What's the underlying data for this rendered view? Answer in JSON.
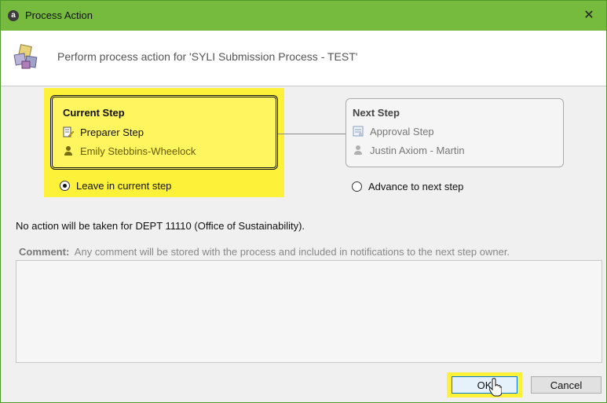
{
  "window": {
    "title": "Process Action",
    "app_icon_letter": "a",
    "close_glyph": "✕"
  },
  "header": {
    "text": "Perform process action for 'SYLI Submission Process - TEST'",
    "icon": "process-cubes-icon"
  },
  "current_step": {
    "title": "Current Step",
    "step_name": "Preparer Step",
    "step_icon": "edit-document-icon",
    "owner": "Emily Stebbins-Wheelock",
    "owner_icon": "user-icon"
  },
  "next_step": {
    "title": "Next Step",
    "step_name": "Approval Step",
    "step_icon": "approval-document-icon",
    "owner": "Justin Axiom - Martin",
    "owner_icon": "user-icon"
  },
  "options": {
    "leave_label": "Leave in current step",
    "leave_selected": true,
    "advance_label": "Advance to next step",
    "advance_selected": false
  },
  "info_text": "No action will be taken for DEPT 11110 (Office of Sustainability).",
  "comment": {
    "label": "Comment:",
    "hint": "Any comment will be stored with the process and included in notifications to the next step owner.",
    "value": ""
  },
  "buttons": {
    "ok": "OK",
    "cancel": "Cancel"
  },
  "colors": {
    "titlebar": "#76bb3e",
    "highlight": "#fdf13a"
  }
}
